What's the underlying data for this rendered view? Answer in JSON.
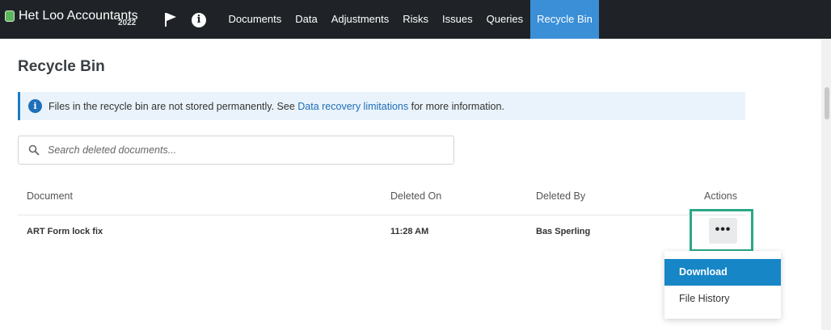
{
  "app": {
    "brand_name": "Het Loo Accountants",
    "brand_year": "2022",
    "icons": {
      "flag": "flag-icon",
      "info": "info-icon",
      "search": "search-icon",
      "more": "more-horizontal-icon"
    }
  },
  "nav": {
    "items": [
      {
        "label": "Documents",
        "active": false
      },
      {
        "label": "Data",
        "active": false
      },
      {
        "label": "Adjustments",
        "active": false
      },
      {
        "label": "Risks",
        "active": false
      },
      {
        "label": "Issues",
        "active": false
      },
      {
        "label": "Queries",
        "active": false
      },
      {
        "label": "Recycle Bin",
        "active": true
      }
    ]
  },
  "page": {
    "title": "Recycle Bin",
    "notice": {
      "before": "Files in the recycle bin are not stored permanently. See ",
      "link": "Data recovery limitations",
      "after": " for more information."
    },
    "search": {
      "placeholder": "Search deleted documents...",
      "value": ""
    }
  },
  "table": {
    "headers": {
      "document": "Document",
      "deleted_on": "Deleted On",
      "deleted_by": "Deleted By",
      "actions": "Actions"
    },
    "rows": [
      {
        "document": "ART Form lock fix",
        "deleted_on": "11:28 AM",
        "deleted_by": "Bas Sperling",
        "actions_label": "•••"
      }
    ]
  },
  "menu": {
    "items": [
      {
        "label": "Download",
        "selected": true
      },
      {
        "label": "File History",
        "selected": false
      }
    ]
  },
  "colors": {
    "topbar": "#1f2327",
    "active_tab": "#3a8fd6",
    "link": "#1d6fb8",
    "highlight_border": "#2aa888",
    "menu_selected": "#1686c7"
  }
}
